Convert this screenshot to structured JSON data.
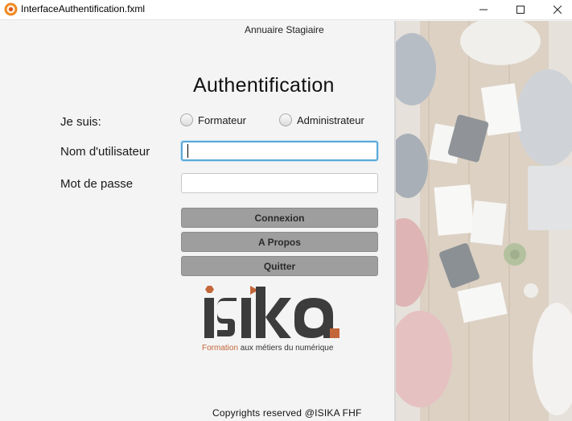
{
  "window": {
    "title": "InterfaceAuthentification.fxml",
    "minimize_glyph": "—",
    "maximize_glyph": "□",
    "close_glyph": "✕"
  },
  "header": {
    "label": "Annuaire Stagiaire"
  },
  "form": {
    "title": "Authentification",
    "role_label": "Je suis:",
    "role_options": [
      "Formateur",
      "Administrateur"
    ],
    "username_label": "Nom d'utilisateur",
    "username_value": "",
    "password_label": "Mot de passe",
    "password_value": ""
  },
  "buttons": {
    "connexion": "Connexion",
    "apropos": "A Propos",
    "quitter": "Quitter"
  },
  "logo": {
    "wordmark": "isika",
    "tagline_accent": "Formation",
    "tagline_rest": " aux métiers du numérique",
    "accent_color": "#c3663a",
    "text_color": "#3c3c3c"
  },
  "footer": {
    "text": "Copyrights reserved @ISIKA FHF"
  },
  "icons": [
    "app-icon",
    "minimize-icon",
    "maximize-icon",
    "close-icon"
  ],
  "colors": {
    "button_bg": "#9e9e9e",
    "focus_border": "#5aa9d8",
    "panel_bg": "#f4f4f4"
  }
}
